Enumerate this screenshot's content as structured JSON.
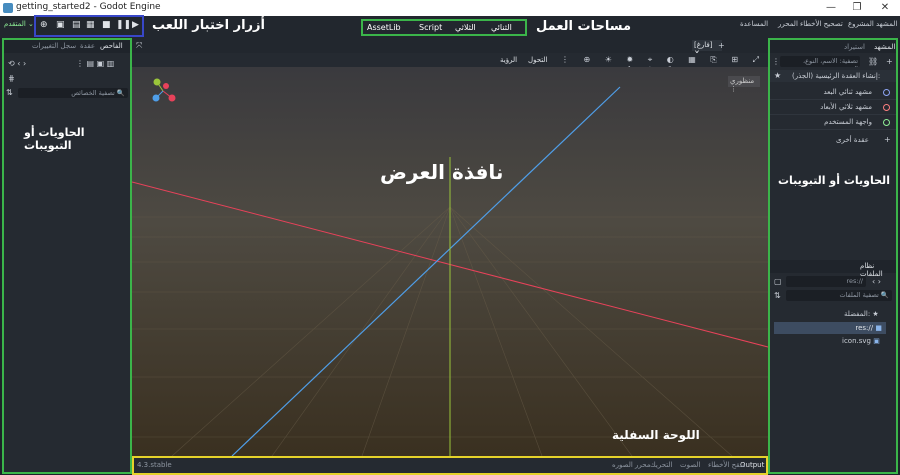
{
  "window": {
    "title": "getting_started2 - Godot Engine",
    "minimize": "—",
    "maximize": "❐",
    "close": "✕"
  },
  "menu": {
    "items": [
      "المشهد",
      "المشروع",
      "تصحيح الأخطاء",
      "المحرر",
      "المساعدة"
    ],
    "advanced": "المتقدم ⌄"
  },
  "workspaces": {
    "label": "مساحات العمل",
    "twod": "الثنائي",
    "threed": "الثلاثي",
    "script": "Script",
    "assetlib": "AssetLib"
  },
  "play": {
    "label": "أزرار اختبار اللعب"
  },
  "left_dock": {
    "tabs": [
      "الفاحص",
      "عقدة",
      "سجل التغييرات"
    ],
    "filter_placeholder": "تصفية الخصائص",
    "annotation": "الحاويات أو التبويبات"
  },
  "viewport": {
    "tab_label": "[فارغ]",
    "menu_view": "الرؤية",
    "menu_transform": "التحول",
    "perspective": "منظوري",
    "annotation": "نافذة العرض"
  },
  "scene_dock": {
    "tabs": [
      "المشهد",
      "استيراد"
    ],
    "filter_placeholder": "تصفية: الاسم، النوع، المجموعة",
    "root_label": "إنشاء العقدة الرئيسية (الجذر):",
    "options": [
      {
        "label": "مشهد ثنائي البعد",
        "color": "#8da5f3"
      },
      {
        "label": "مشهد ثلاثي الأبعاد",
        "color": "#fc7f7f"
      },
      {
        "label": "واجهة المستخدم",
        "color": "#8eef97"
      }
    ],
    "other": "عقدة أخرى",
    "annotation": "الحاويات أو التبويبات"
  },
  "filesystem": {
    "tab": "نظام الملفات",
    "path": "res://",
    "filter_placeholder": "تصفية الملفات",
    "favorites": "المفضلة:",
    "items": [
      "res://",
      "icon.svg"
    ]
  },
  "bottom": {
    "version": "4.3.stable",
    "tabs": [
      "Output",
      "منقح الأخطاء",
      "الصوت",
      "التحريك",
      "محرر الصوره"
    ],
    "annotation": "اللوحة السفلية"
  }
}
